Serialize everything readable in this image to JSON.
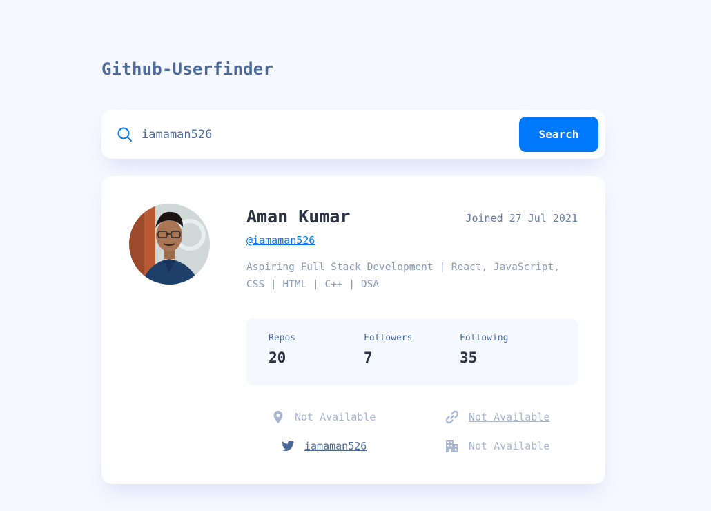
{
  "app": {
    "title": "Github-Userfinder"
  },
  "search": {
    "value": "iamaman526",
    "button_label": "Search",
    "icon": "search-icon"
  },
  "profile": {
    "name": "Aman Kumar",
    "joined": "Joined 27 Jul 2021",
    "login": "@iamaman526",
    "bio_line1": "Aspiring Full Stack Development | React, JavaScript,",
    "bio_line2": "CSS | HTML | C++ | DSA",
    "stats": {
      "repos": {
        "label": "Repos",
        "value": "20"
      },
      "followers": {
        "label": "Followers",
        "value": "7"
      },
      "following": {
        "label": "Following",
        "value": "35"
      }
    },
    "info": {
      "location": {
        "icon": "location-pin-icon",
        "text": "Not Available"
      },
      "blog": {
        "icon": "link-icon",
        "text": "Not Available"
      },
      "twitter": {
        "icon": "twitter-icon",
        "text": "iamaman526"
      },
      "company": {
        "icon": "building-icon",
        "text": "Not Available"
      }
    }
  },
  "colors": {
    "background": "#f6f8ff",
    "card": "#fefefe",
    "accent": "#0079ff",
    "heading": "#2b3442",
    "text": "#4b6a9b",
    "muted": "#a8b7cf"
  }
}
